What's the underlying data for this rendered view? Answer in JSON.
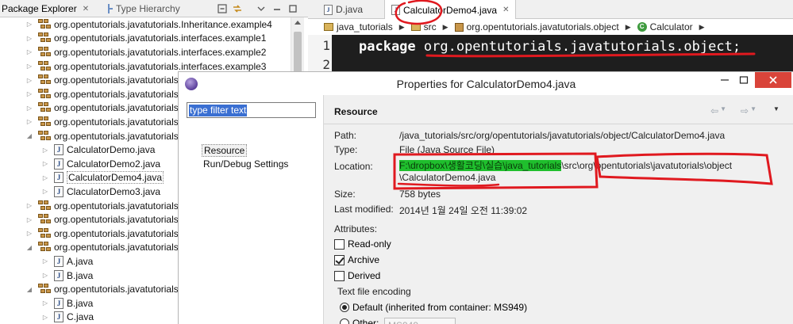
{
  "package_explorer": {
    "tab_active": "Package Explorer",
    "tab_inactive": "Type Hierarchy",
    "rows": [
      {
        "kind": "package",
        "label": "org.opentutorials.javatutorials.Inheritance.example4",
        "expanded": false
      },
      {
        "kind": "package",
        "label": "org.opentutorials.javatutorials.interfaces.example1",
        "expanded": false
      },
      {
        "kind": "package",
        "label": "org.opentutorials.javatutorials.interfaces.example2",
        "expanded": false
      },
      {
        "kind": "package",
        "label": "org.opentutorials.javatutorials.interfaces.example3",
        "expanded": false
      },
      {
        "kind": "package",
        "label": "org.opentutorials.javatutorials",
        "expanded": false
      },
      {
        "kind": "package",
        "label": "org.opentutorials.javatutorials",
        "expanded": false
      },
      {
        "kind": "package",
        "label": "org.opentutorials.javatutorials",
        "expanded": false
      },
      {
        "kind": "package",
        "label": "org.opentutorials.javatutorials",
        "expanded": false
      },
      {
        "kind": "package",
        "label": "org.opentutorials.javatutorials",
        "expanded": true
      },
      {
        "kind": "file",
        "label": "CalculatorDemo.java"
      },
      {
        "kind": "file",
        "label": "CalculatorDemo2.java"
      },
      {
        "kind": "file",
        "label": "CalculatorDemo4.java",
        "selected": true
      },
      {
        "kind": "file",
        "label": "ClaculatorDemo3.java"
      },
      {
        "kind": "package",
        "label": "org.opentutorials.javatutorials",
        "expanded": false
      },
      {
        "kind": "package",
        "label": "org.opentutorials.javatutorials",
        "expanded": false
      },
      {
        "kind": "package",
        "label": "org.opentutorials.javatutorials",
        "expanded": false
      },
      {
        "kind": "package",
        "label": "org.opentutorials.javatutorials",
        "expanded": true
      },
      {
        "kind": "file",
        "label": "A.java"
      },
      {
        "kind": "file",
        "label": "B.java"
      },
      {
        "kind": "package",
        "label": "org.opentutorials.javatutorials",
        "expanded": true
      },
      {
        "kind": "file",
        "label": "B.java"
      },
      {
        "kind": "file",
        "label": "C.java"
      }
    ]
  },
  "editor": {
    "tab1": "D.java",
    "tab2": "CalculatorDemo4.java",
    "breadcrumb": [
      "java_tutorials",
      "src",
      "org.opentutorials.javatutorials.object",
      "Calculator"
    ],
    "line1_no": "1",
    "line2_no": "2",
    "code_keyword": "package",
    "code_rest": " org.opentutorials.javatutorials.object;"
  },
  "dialog": {
    "title": "Properties for CalculatorDemo4.java",
    "filter_text": "type filter text",
    "nav": [
      "Resource",
      "Run/Debug Settings"
    ],
    "section_title": "Resource",
    "labels": {
      "path": "Path:",
      "type": "Type:",
      "location": "Location:",
      "size": "Size:",
      "modified": "Last modified:"
    },
    "values": {
      "path": "/java_tutorials/src/org/opentutorials/javatutorials/object/CalculatorDemo4.java",
      "type": "File  (Java Source File)",
      "location_part1": "F:\\dropbox\\생활코딩\\실습\\java_tutorials",
      "location_part2": "\\src\\org\\opentutorials\\javatutorials\\object",
      "location_line2": "\\CalculatorDemo4.java",
      "size": "758  bytes",
      "modified": "2014년 1월 24일 오전 11:39:02"
    },
    "attributes_label": "Attributes:",
    "checkboxes": [
      {
        "label": "Read-only",
        "checked": false
      },
      {
        "label": "Archive",
        "checked": true
      },
      {
        "label": "Derived",
        "checked": false
      }
    ],
    "encoding_label": "Text file encoding",
    "radio_default": "Default (inherited from container: MS949)",
    "radio_other": "Other:",
    "other_value": "MS949"
  },
  "colors": {
    "highlight_green": "#1fbf2d",
    "annotation_red": "#e0191f",
    "close_button": "#d9443a",
    "code_bg": "#1e1e1e"
  }
}
